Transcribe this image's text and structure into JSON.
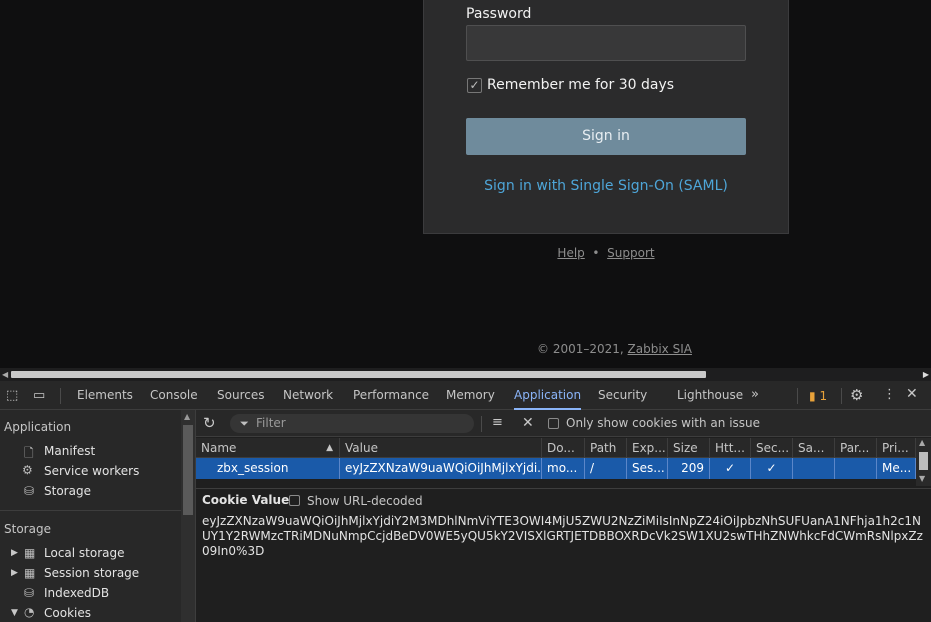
{
  "login": {
    "password_label": "Password",
    "remember_label": "Remember me for 30 days",
    "remember_checked": true,
    "signin_label": "Sign in",
    "saml_label": "Sign in with Single Sign-On (SAML)",
    "help_label": "Help",
    "bullet": "•",
    "support_label": "Support",
    "copyright_prefix": "© 2001–2021, ",
    "copyright_link": "Zabbix SIA"
  },
  "devtools": {
    "tabs": [
      "Elements",
      "Console",
      "Sources",
      "Network",
      "Performance",
      "Memory",
      "Application",
      "Security",
      "Lighthouse"
    ],
    "active_tab": "Application",
    "issues_count": "1",
    "sidebar": {
      "application_header": "Application",
      "application_items": [
        "Manifest",
        "Service workers",
        "Storage"
      ],
      "storage_header": "Storage",
      "storage_items": [
        "Local storage",
        "Session storage",
        "IndexedDB",
        "Cookies"
      ]
    },
    "cookies": {
      "filter_placeholder": "Filter",
      "only_issues_label": "Only show cookies with an issue",
      "columns": [
        "Name",
        "Value",
        "Do...",
        "Path",
        "Exp...",
        "Size",
        "Htt...",
        "Sec...",
        "Sa...",
        "Par...",
        "Pri..."
      ],
      "row": {
        "name": "zbx_session",
        "value": "eyJzZXNzaW9uaWQiOiJhMjlxYjdi...",
        "domain": "mo...",
        "path": "/",
        "expires": "Ses...",
        "size": "209",
        "httponly": "✓",
        "secure": "✓",
        "samesite": "",
        "partition": "",
        "priority": "Me..."
      },
      "value_pane_title": "Cookie Value",
      "show_url_decoded_label": "Show URL-decoded",
      "full_value": "eyJzZXNzaW9uaWQiOiJhMjlxYjdiY2M3MDhlNmViYTE3OWI4MjU5ZWU2NzZiMiIsInNpZ24iOiJpbzNhSUFUanA1NFhja1h2c1NUY1Y2RWMzcTRiMDNuNmpCcjdBeDV0WE5yQU5kY2VISXlGRTJETDBBOXRDcVk2SW1XU2swTHhZNWhkcFdCWmRsNlpxZz09In0%3D"
    }
  }
}
